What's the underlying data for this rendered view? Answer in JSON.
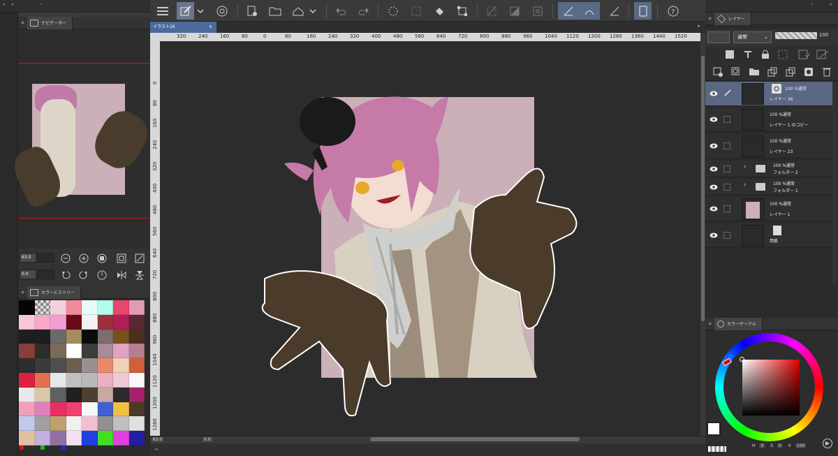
{
  "navigator": {
    "tab_label": "ナビゲーター",
    "zoom_value": "63.0",
    "rotate_value": "0.0"
  },
  "color_history": {
    "tab_label": "カラーヒストリー",
    "swatches": [
      "#050505",
      "#9a9a9a",
      "#f4d2dd",
      "#f08a9a",
      "#e8fbfb",
      "#b2fbee",
      "#e8466a",
      "#e19bb2",
      "#f7c6d8",
      "#f7a8c8",
      "#f29dd3",
      "#6a0a16",
      "#f2f2f2",
      "#9d2f3a",
      "#ad1f57",
      "#5a2834",
      "#1e1e1e",
      "#1e1e1e",
      "#6a6a6a",
      "#a88c5e",
      "#0c0c0c",
      "#7a6e6e",
      "#7a4f1a",
      "#4a2f1e",
      "#8a3d3a",
      "#2c2c2c",
      "#7b6a55",
      "#ffffff",
      "#3c3c3c",
      "#a88a98",
      "#e0a3c0",
      "#b48090",
      "#2e2e2e",
      "#3a3a3a",
      "#4e4e4e",
      "#6e5e4e",
      "#989090",
      "#e88a6a",
      "#f0d0b8",
      "#d0603a",
      "#e02040",
      "#e07050",
      "#e8e8e8",
      "#c0c0c0",
      "#b8b8b8",
      "#e8b0c0",
      "#f0c8d8",
      "#f8f8f8",
      "#e8e8e8",
      "#d8c8a8",
      "#606060",
      "#202020",
      "#4e4030",
      "#c8a8a0",
      "#2a2a2a",
      "#a8206a",
      "#f0a0b8",
      "#e080c0",
      "#e83060",
      "#f04070",
      "#f8f8f8",
      "#4060d0",
      "#f0c040",
      "#4a3a2a",
      "#c0c8f0",
      "#a0a0a0",
      "#c0a070",
      "#f0f0f0",
      "#f0c0d0",
      "#909090",
      "#c0c0c0",
      "#e0e0e0",
      "#e0c0a0",
      "#c0b0e0",
      "#9070a0",
      "#f0e0f0",
      "#2040e0",
      "#40e020",
      "#e040e0",
      "#2020a0"
    ]
  },
  "document": {
    "tab_title": "イラスト26",
    "ruler_top_labels": [
      "320",
      "240",
      "160",
      "80",
      "0",
      "80",
      "160",
      "240",
      "320",
      "400",
      "480",
      "560",
      "640",
      "720",
      "800",
      "880",
      "960",
      "1040",
      "1120",
      "1200",
      "1280",
      "1360",
      "1440",
      "1520"
    ],
    "ruler_left_labels": [
      "0",
      "80",
      "160",
      "240",
      "320",
      "400",
      "480",
      "560",
      "640",
      "720",
      "800",
      "880",
      "960",
      "1040",
      "1120",
      "1200",
      "1280"
    ],
    "status_zoom": "63.0",
    "status_rotation": "0.0"
  },
  "layers_panel": {
    "tab_label": "レイヤー",
    "blend_mode": "通常",
    "opacity": "100",
    "layers": [
      {
        "line1": "100 %通常",
        "line2": "レイヤー 36",
        "selected": true,
        "kind": "raster"
      },
      {
        "line1": "100 %通常",
        "line2": "レイヤー 1 のコピー",
        "selected": false,
        "kind": "raster"
      },
      {
        "line1": "100 %通常",
        "line2": "レイヤー 23",
        "selected": false,
        "kind": "raster"
      },
      {
        "line1": "100 %通常",
        "line2": "フォルダー 2",
        "selected": false,
        "kind": "folder"
      },
      {
        "line1": "100 %通常",
        "line2": "フォルダー 1",
        "selected": false,
        "kind": "folder"
      },
      {
        "line1": "100 %通常",
        "line2": "レイヤー 1",
        "selected": false,
        "kind": "pink"
      },
      {
        "line1": "",
        "line2": "用紙",
        "selected": false,
        "kind": "paper"
      }
    ]
  },
  "color_panel": {
    "tab_label": "カラーサークル",
    "h_label": "H",
    "h_value": "0",
    "s_label": "S",
    "s_value": "0",
    "v_label": "V",
    "v_value": "100"
  },
  "colors": {
    "accent": "#5a6884",
    "canvas_bg": "#2c2c2c",
    "artwork_bg": "#cbb0b8"
  }
}
